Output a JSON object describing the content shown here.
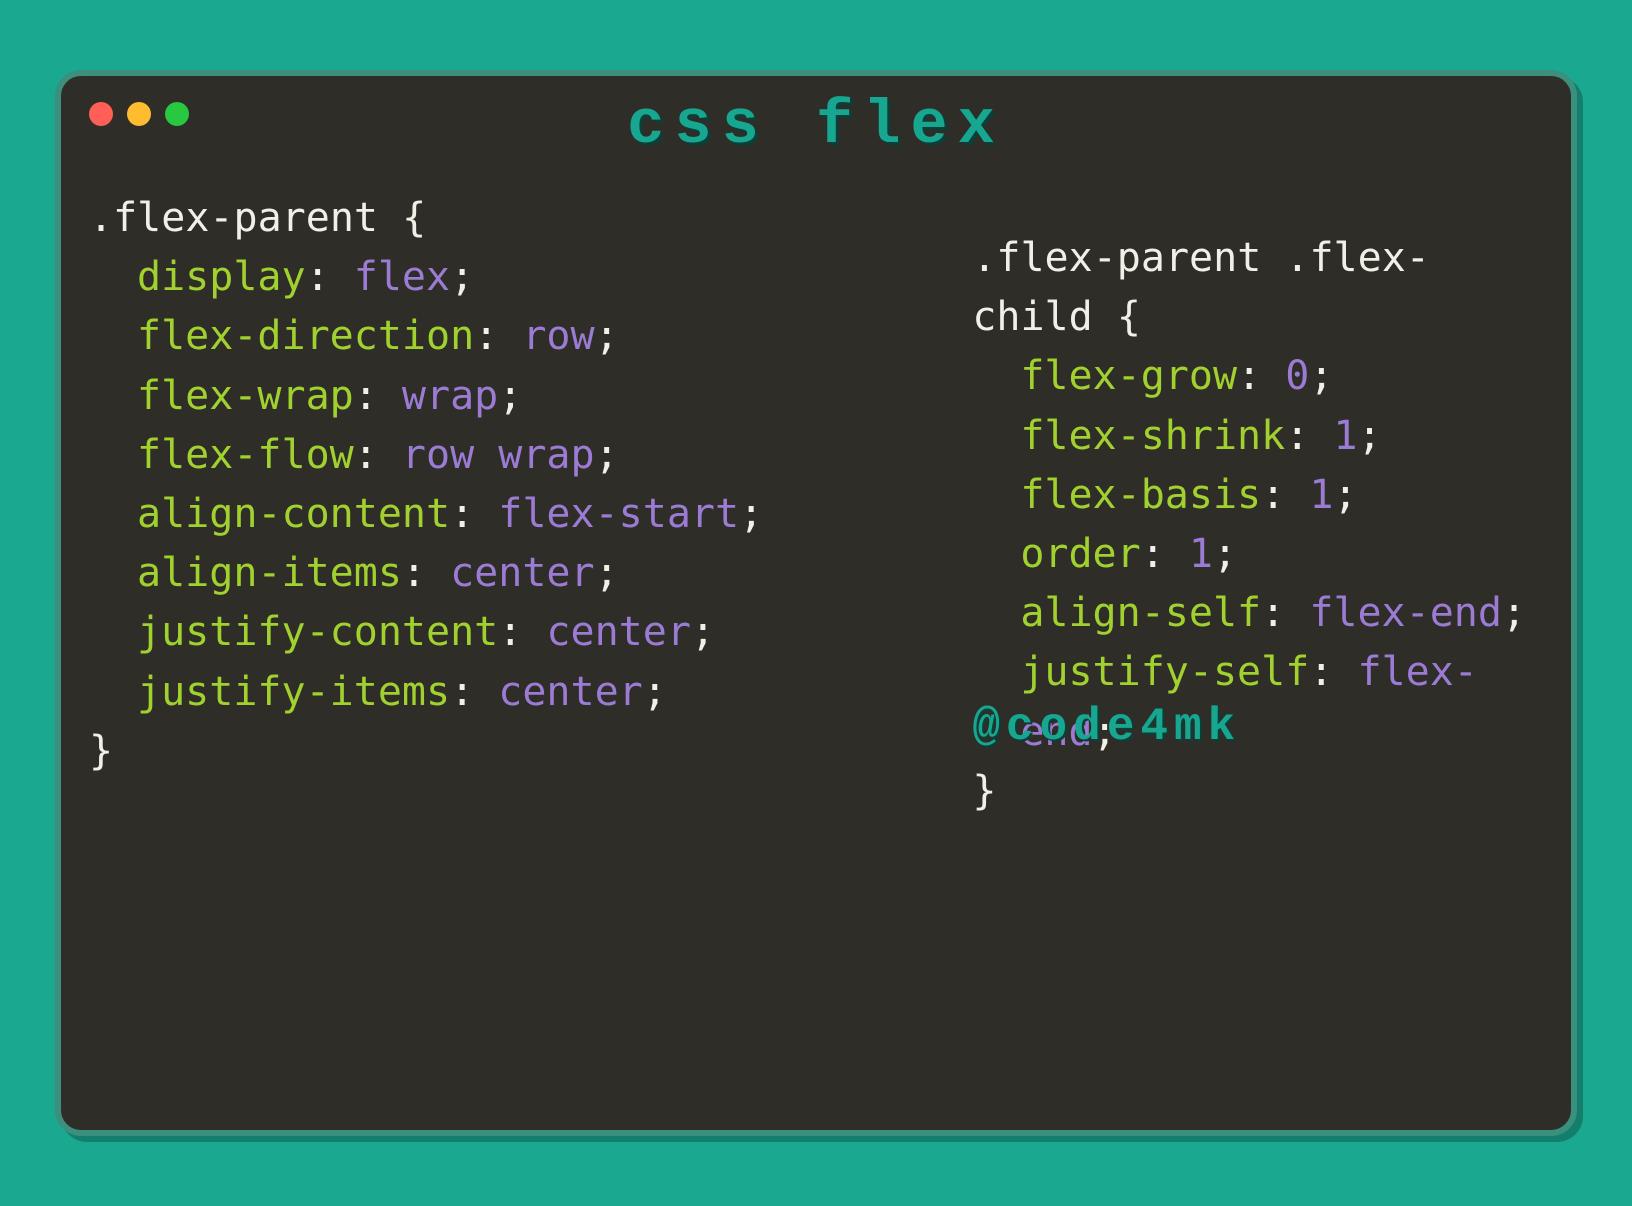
{
  "title": "css flex",
  "credit": "@code4mk",
  "colors": {
    "bg": "#1aa890",
    "panel": "#2e2d27",
    "accent": "#17a790",
    "property": "#a1d12e",
    "value": "#9b7bd4",
    "text": "#f2efe6"
  },
  "left": {
    "selector": ".flex-parent",
    "rules": [
      {
        "prop": "display",
        "val": "flex"
      },
      {
        "prop": "flex-direction",
        "val": "row"
      },
      {
        "prop": "flex-wrap",
        "val": "wrap"
      },
      {
        "prop": "flex-flow",
        "val": "row wrap"
      },
      {
        "prop": "align-content",
        "val": "flex-start"
      },
      {
        "prop": "align-items",
        "val": "center"
      },
      {
        "prop": "justify-content",
        "val": "center"
      },
      {
        "prop": "justify-items",
        "val": "center"
      }
    ]
  },
  "right": {
    "selector": ".flex-parent .flex-child",
    "rules": [
      {
        "prop": "flex-grow",
        "val": "0"
      },
      {
        "prop": "flex-shrink",
        "val": "1"
      },
      {
        "prop": "flex-basis",
        "val": "1"
      },
      {
        "prop": "order",
        "val": "1"
      },
      {
        "prop": "align-self",
        "val": "flex-end"
      },
      {
        "prop": "justify-self",
        "val": "flex-end"
      }
    ]
  }
}
